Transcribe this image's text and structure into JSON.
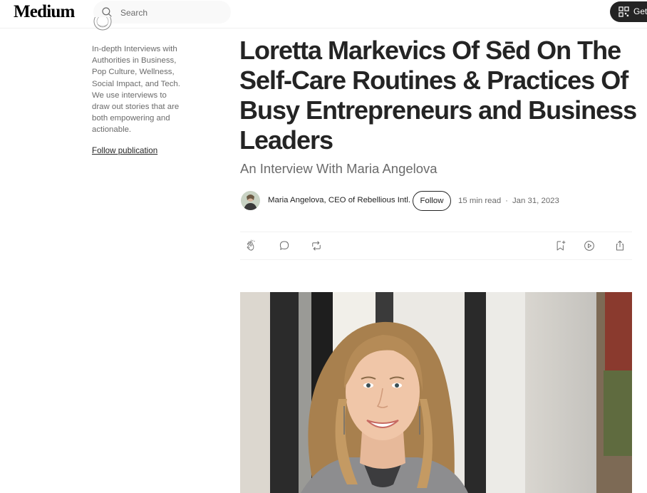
{
  "header": {
    "logo": "Medium",
    "search_placeholder": "Search",
    "get_app_label": "Get"
  },
  "publication": {
    "description": "In-depth Interviews with Authorities in Business, Pop Culture, Wellness, Social Impact, and Tech. We use interviews to draw out stories that are both empowering and actionable.",
    "follow_label": "Follow publication"
  },
  "article": {
    "title": "Loretta Markevics Of Sēd On The Self-Care Routines & Practices Of Busy Entrepreneurs and Business Leaders",
    "subtitle": "An Interview With Maria Angelova",
    "author": "Maria Angelova, CEO of Rebellious Intl.",
    "follow_label": "Follow",
    "read_time": "15 min read",
    "separator": "·",
    "date": "Jan 31, 2023"
  },
  "actions": {
    "left": [
      "clap-icon",
      "comment-icon",
      "repost-icon"
    ],
    "right": [
      "bookmark-add-icon",
      "listen-icon",
      "share-icon"
    ]
  },
  "colors": {
    "text": "#242424",
    "muted": "#6b6b6b",
    "button_dark": "#242424",
    "divider": "#f2f2f2"
  }
}
